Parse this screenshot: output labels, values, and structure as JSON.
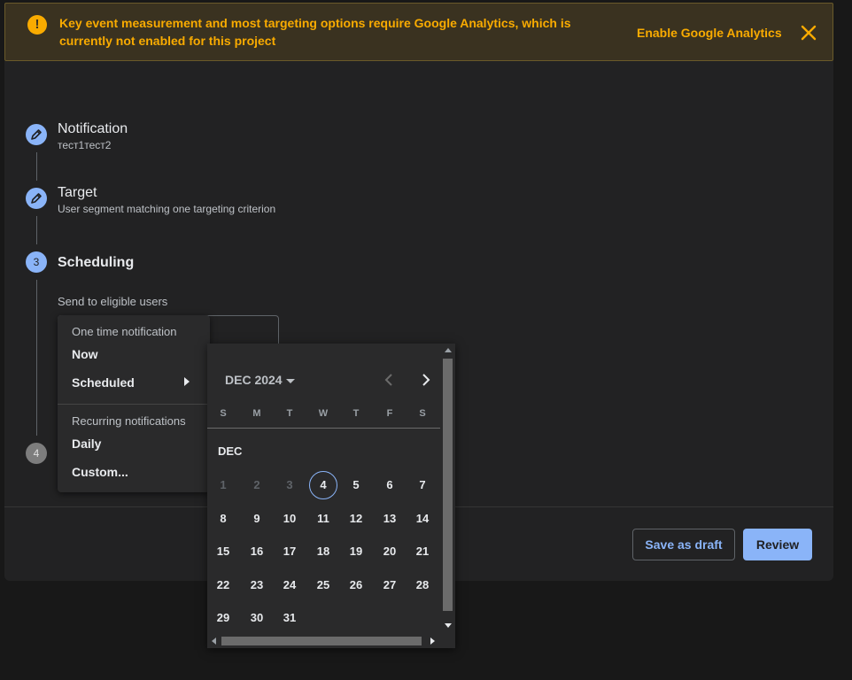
{
  "banner": {
    "message": "Key event measurement and most targeting options require Google Analytics, which is currently not enabled for this project",
    "action_label": "Enable Google Analytics",
    "icon": "warning-icon",
    "close_icon": "close-icon"
  },
  "steps": [
    {
      "number": "1",
      "title": "Notification",
      "subtitle": "тест1тест2",
      "icon": "pencil-icon"
    },
    {
      "number": "2",
      "title": "Target",
      "subtitle": "User segment matching one targeting criterion",
      "icon": "pencil-icon"
    },
    {
      "number": "3",
      "title": "Scheduling"
    },
    {
      "number": "4"
    }
  ],
  "scheduling": {
    "send_label": "Send to eligible users"
  },
  "menu": {
    "one_time_header": "One time notification",
    "items_one_time": [
      "Now",
      "Scheduled"
    ],
    "recurring_header": "Recurring notifications",
    "items_recurring": [
      "Daily",
      "Custom..."
    ]
  },
  "calendar": {
    "period_label": "DEC 2024",
    "month_label": "DEC",
    "weekdays": [
      "S",
      "M",
      "T",
      "W",
      "T",
      "F",
      "S"
    ],
    "today": 4,
    "disabled_until": 3,
    "days": [
      1,
      2,
      3,
      4,
      5,
      6,
      7,
      8,
      9,
      10,
      11,
      12,
      13,
      14,
      15,
      16,
      17,
      18,
      19,
      20,
      21,
      22,
      23,
      24,
      25,
      26,
      27,
      28,
      29,
      30,
      31
    ],
    "first_weekday": 0
  },
  "footer": {
    "save_draft_label": "Save as draft",
    "review_label": "Review"
  },
  "colors": {
    "accent": "#8ab4f8",
    "warning": "#f9ab00"
  }
}
